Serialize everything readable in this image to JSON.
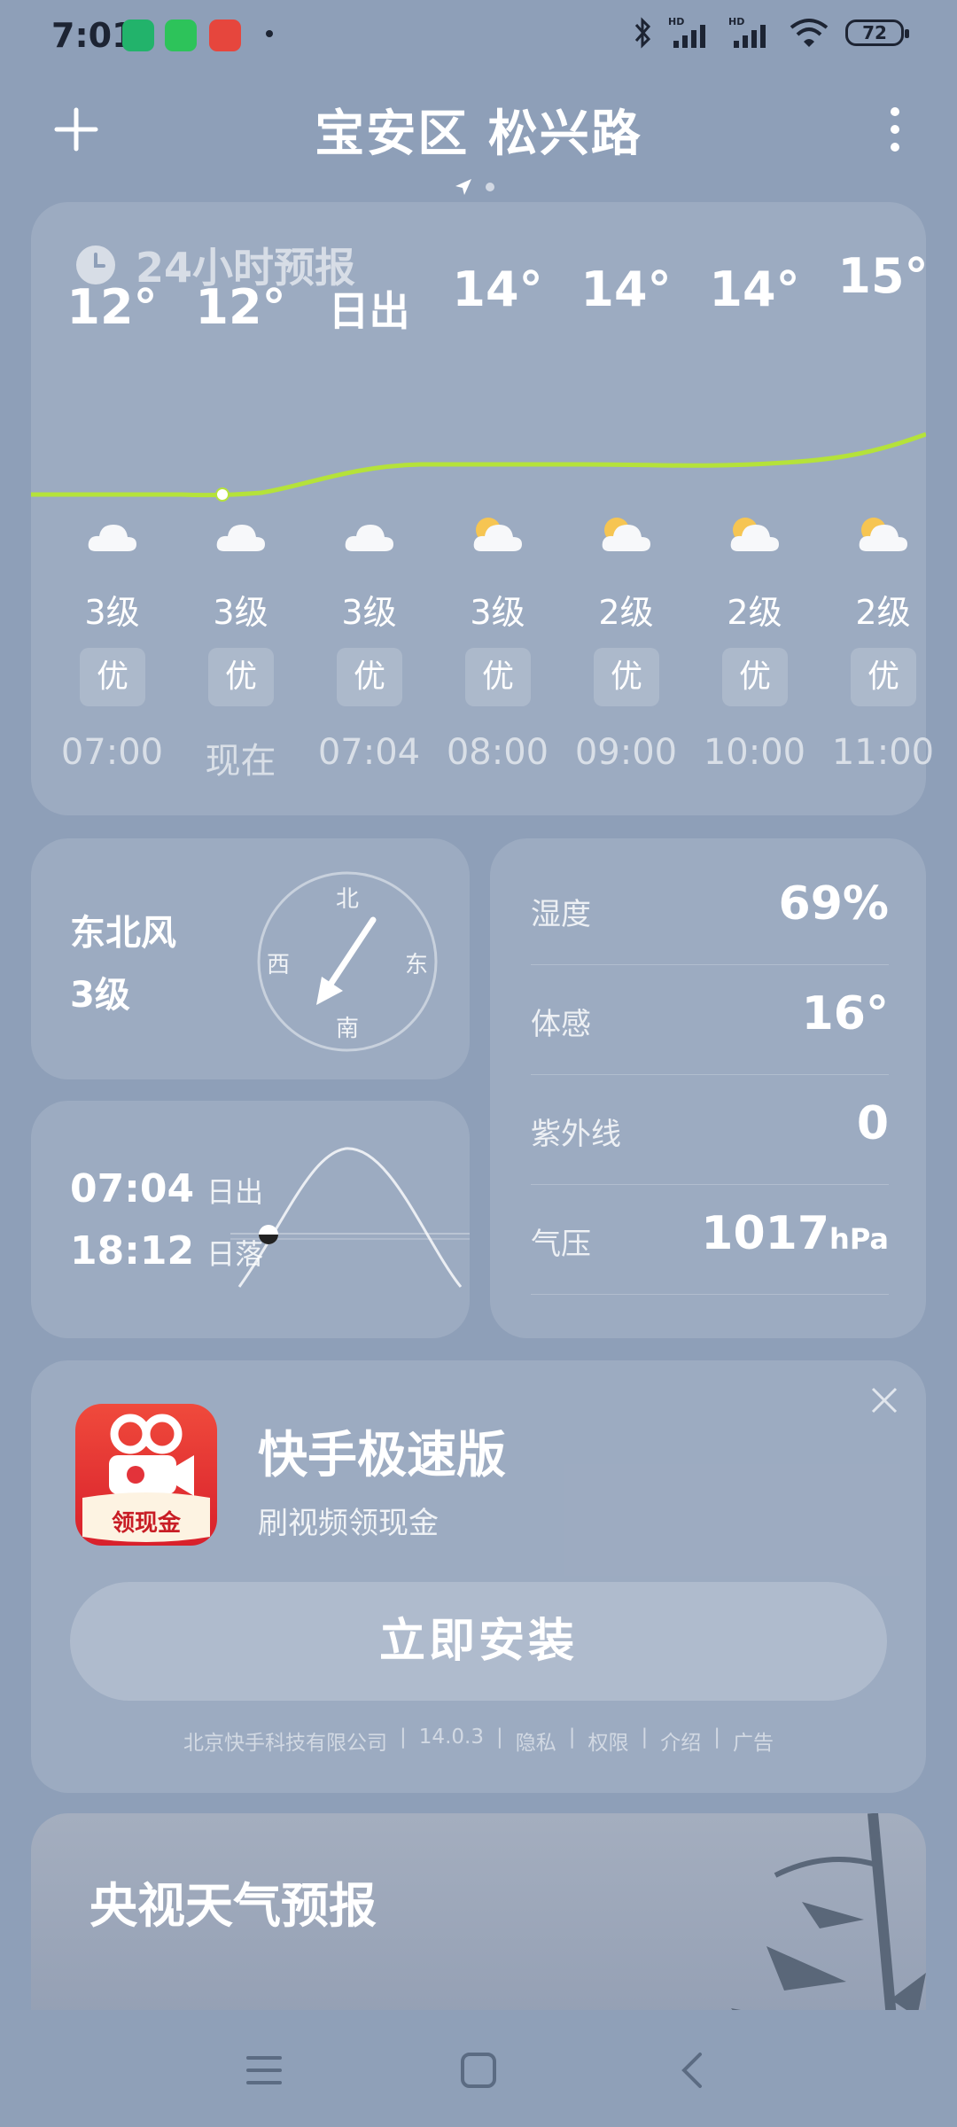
{
  "status": {
    "time": "7:01",
    "battery": "72"
  },
  "header": {
    "title": "宝安区 松兴路"
  },
  "hourly": {
    "title": "24小时预报",
    "items": [
      {
        "temp": "12°",
        "wind": "3级",
        "aqi": "优",
        "time": "07:00",
        "icon": "cloudy-icon"
      },
      {
        "temp": "12°",
        "wind": "3级",
        "aqi": "优",
        "time": "现在",
        "icon": "cloudy-icon"
      },
      {
        "temp": "日出",
        "wind": "3级",
        "aqi": "优",
        "time": "07:04",
        "icon": "cloudy-icon"
      },
      {
        "temp": "14°",
        "wind": "3级",
        "aqi": "优",
        "time": "08:00",
        "icon": "partly-cloudy-icon"
      },
      {
        "temp": "14°",
        "wind": "2级",
        "aqi": "优",
        "time": "09:00",
        "icon": "partly-cloudy-icon"
      },
      {
        "temp": "14°",
        "wind": "2级",
        "aqi": "优",
        "time": "10:00",
        "icon": "partly-cloudy-icon"
      },
      {
        "temp": "15°",
        "wind": "2级",
        "aqi": "优",
        "time": "11:00",
        "icon": "partly-cloudy-icon"
      }
    ]
  },
  "wind": {
    "direction": "东北风",
    "level": "3级",
    "north": "北",
    "south": "南",
    "east": "东",
    "west": "西"
  },
  "sun": {
    "rise_time": "07:04",
    "rise_label": "日出",
    "set_time": "18:12",
    "set_label": "日落"
  },
  "details": [
    {
      "label": "湿度",
      "value": "69%",
      "unit": ""
    },
    {
      "label": "体感",
      "value": "16°",
      "unit": ""
    },
    {
      "label": "紫外线",
      "value": "0",
      "unit": ""
    },
    {
      "label": "气压",
      "value": "1017",
      "unit": "hPa"
    }
  ],
  "ad": {
    "app_name": "快手极速版",
    "description": "刷视频领现金",
    "logo_text": "领现金",
    "install_label": "立即安装",
    "footer": [
      "北京快手科技有限公司",
      "|",
      "14.0.3",
      "|",
      "隐私",
      "|",
      "权限",
      "|",
      "介绍",
      "|",
      "广告"
    ]
  },
  "cctv": {
    "title": "央视天气预报"
  },
  "colors": {
    "accent_line": "#b5e23a",
    "background": "#8e9fb8"
  }
}
